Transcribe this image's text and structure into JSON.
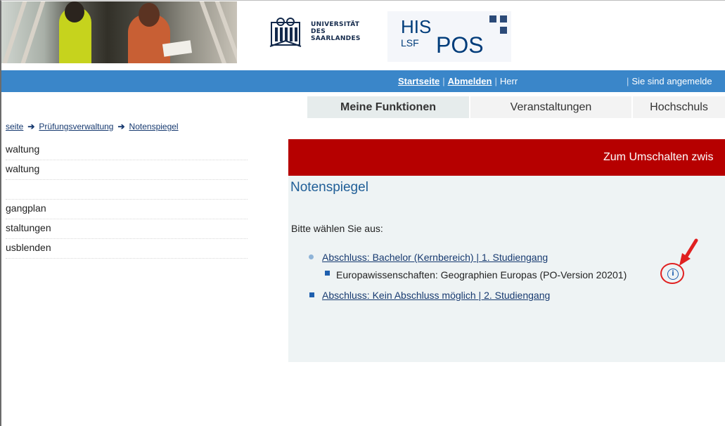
{
  "header": {
    "university_lines": [
      "UNIVERSITÄT",
      "DES",
      "SAARLANDES"
    ],
    "his": "HIS",
    "lsf": "LSF",
    "pos": "POS"
  },
  "topnav": {
    "home": "Startseite",
    "logout": "Abmelden",
    "user": "Herr",
    "signed_in": "Sie sind angemelde"
  },
  "tabs": [
    {
      "label": "Meine Funktionen",
      "active": true
    },
    {
      "label": "Veranstaltungen",
      "active": false
    },
    {
      "label": "Hochschuls",
      "active": false
    }
  ],
  "breadcrumb": [
    "seite",
    "Prüfungsverwaltung",
    "Notenspiegel"
  ],
  "left_menu": [
    "waltung",
    "waltung",
    "",
    "gangplan",
    "staltungen",
    "usblenden"
  ],
  "banner": "Zum Umschalten zwis",
  "main": {
    "title": "Notenspiegel",
    "prompt": "Bitte wählen Sie aus:",
    "entries": [
      {
        "label": "Abschluss: Bachelor (Kernbereich) | 1. Studiengang",
        "link": true
      },
      {
        "label": "Europawissenschaften: Geographien Europas (PO-Version 20201)",
        "link": false
      },
      {
        "label": "Abschluss: Kein Abschluss möglich | 2. Studiengang",
        "link": true
      }
    ],
    "info_symbol": "i"
  },
  "colors": {
    "blue_bar": "#3a86c9",
    "banner_red": "#b60000",
    "link": "#173a70",
    "annotation_red": "#e02020"
  }
}
